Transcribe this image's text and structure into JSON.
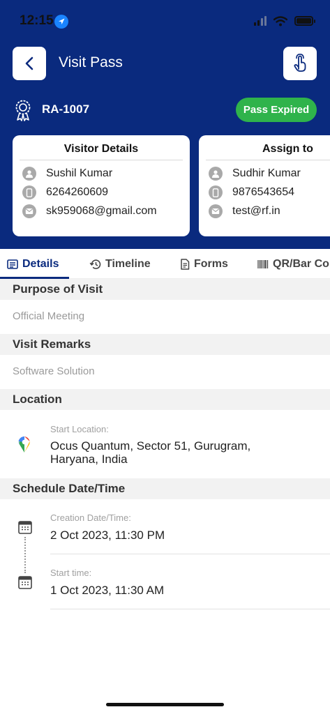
{
  "status_bar": {
    "time": "12:15"
  },
  "header": {
    "title": "Visit Pass",
    "pass_id": "RA-1007",
    "status": "Pass Expired"
  },
  "visitor_card": {
    "title": "Visitor Details",
    "name": "Sushil Kumar",
    "phone": "6264260609",
    "email": "sk959068@gmail.com"
  },
  "assign_card": {
    "title": "Assign to",
    "name": "Sudhir Kumar",
    "phone": "9876543654",
    "email": "test@rf.in"
  },
  "tabs": [
    {
      "label": "Details",
      "icon": "list-icon"
    },
    {
      "label": "Timeline",
      "icon": "history-icon"
    },
    {
      "label": "Forms",
      "icon": "document-icon"
    },
    {
      "label": "QR/Bar Co",
      "icon": "barcode-icon"
    }
  ],
  "purpose": {
    "heading": "Purpose of Visit",
    "value": "Official Meeting"
  },
  "remarks": {
    "heading": "Visit Remarks",
    "value": "Software Solution"
  },
  "location": {
    "heading": "Location",
    "label": "Start Location:",
    "line1": "Ocus Quantum, Sector 51, Gurugram,",
    "line2": "Haryana, India"
  },
  "schedule": {
    "heading": "Schedule Date/Time",
    "creation_label": "Creation Date/Time:",
    "creation_value": "2 Oct 2023, 11:30 PM",
    "start_label": "Start time:",
    "start_value": "1 Oct 2023, 11:30 AM"
  },
  "colors": {
    "primary": "#0a2a7e",
    "expired": "#2fb34b",
    "section_bg": "#f2f2f2"
  }
}
